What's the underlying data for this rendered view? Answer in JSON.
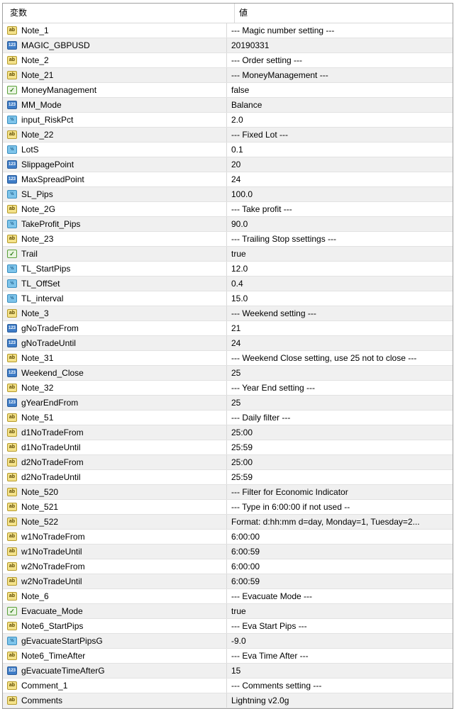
{
  "header": {
    "col_variable": "変数",
    "col_value": "値"
  },
  "icon_legend": {
    "ab": "ab",
    "n123": "123",
    "frac": "½",
    "bool": "✓"
  },
  "rows": [
    {
      "icon": "ab",
      "name": "Note_1",
      "value": "--- Magic number setting ---"
    },
    {
      "icon": "n123",
      "name": "MAGIC_GBPUSD",
      "value": "20190331"
    },
    {
      "icon": "ab",
      "name": "Note_2",
      "value": "--- Order setting ---"
    },
    {
      "icon": "ab",
      "name": "Note_21",
      "value": "--- MoneyManagement ---"
    },
    {
      "icon": "bool",
      "name": "MoneyManagement",
      "value": "false"
    },
    {
      "icon": "n123",
      "name": "MM_Mode",
      "value": "Balance"
    },
    {
      "icon": "frac",
      "name": "input_RiskPct",
      "value": "2.0"
    },
    {
      "icon": "ab",
      "name": "Note_22",
      "value": "--- Fixed Lot ---"
    },
    {
      "icon": "frac",
      "name": "LotS",
      "value": "0.1"
    },
    {
      "icon": "n123",
      "name": "SlippagePoint",
      "value": "20"
    },
    {
      "icon": "n123",
      "name": "MaxSpreadPoint",
      "value": "24"
    },
    {
      "icon": "frac",
      "name": "SL_Pips",
      "value": "100.0"
    },
    {
      "icon": "ab",
      "name": "Note_2G",
      "value": "--- Take profit ---"
    },
    {
      "icon": "frac",
      "name": "TakeProfit_Pips",
      "value": "90.0"
    },
    {
      "icon": "ab",
      "name": "Note_23",
      "value": "--- Trailing Stop ssettings ---"
    },
    {
      "icon": "bool",
      "name": "Trail",
      "value": "true"
    },
    {
      "icon": "frac",
      "name": "TL_StartPips",
      "value": "12.0"
    },
    {
      "icon": "frac",
      "name": "TL_OffSet",
      "value": "0.4"
    },
    {
      "icon": "frac",
      "name": "TL_interval",
      "value": "15.0"
    },
    {
      "icon": "ab",
      "name": "Note_3",
      "value": "--- Weekend setting ---"
    },
    {
      "icon": "n123",
      "name": "gNoTradeFrom",
      "value": "21"
    },
    {
      "icon": "n123",
      "name": "gNoTradeUntil",
      "value": "24"
    },
    {
      "icon": "ab",
      "name": "Note_31",
      "value": "--- Weekend Close setting, use 25 not to close ---"
    },
    {
      "icon": "n123",
      "name": "Weekend_Close",
      "value": "25"
    },
    {
      "icon": "ab",
      "name": "Note_32",
      "value": "--- Year End setting ---"
    },
    {
      "icon": "n123",
      "name": "gYearEndFrom",
      "value": "25"
    },
    {
      "icon": "ab",
      "name": "Note_51",
      "value": "--- Daily filter ---"
    },
    {
      "icon": "ab",
      "name": "d1NoTradeFrom",
      "value": "25:00"
    },
    {
      "icon": "ab",
      "name": "d1NoTradeUntil",
      "value": "25:59"
    },
    {
      "icon": "ab",
      "name": "d2NoTradeFrom",
      "value": "25:00"
    },
    {
      "icon": "ab",
      "name": "d2NoTradeUntil",
      "value": "25:59"
    },
    {
      "icon": "ab",
      "name": "Note_520",
      "value": "--- Filter for Economic Indicator"
    },
    {
      "icon": "ab",
      "name": "Note_521",
      "value": "--- Type in 6:00:00 if not used --"
    },
    {
      "icon": "ab",
      "name": "Note_522",
      "value": "Format: d:hh:mm d=day, Monday=1, Tuesday=2..."
    },
    {
      "icon": "ab",
      "name": "w1NoTradeFrom",
      "value": "6:00:00"
    },
    {
      "icon": "ab",
      "name": "w1NoTradeUntil",
      "value": "6:00:59"
    },
    {
      "icon": "ab",
      "name": "w2NoTradeFrom",
      "value": "6:00:00"
    },
    {
      "icon": "ab",
      "name": "w2NoTradeUntil",
      "value": "6:00:59"
    },
    {
      "icon": "ab",
      "name": "Note_6",
      "value": "--- Evacuate Mode ---"
    },
    {
      "icon": "bool",
      "name": "Evacuate_Mode",
      "value": "true"
    },
    {
      "icon": "ab",
      "name": "Note6_StartPips",
      "value": "--- Eva Start Pips ---"
    },
    {
      "icon": "frac",
      "name": "gEvacuateStartPipsG",
      "value": "-9.0"
    },
    {
      "icon": "ab",
      "name": "Note6_TimeAfter",
      "value": "--- Eva Time After ---"
    },
    {
      "icon": "n123",
      "name": "gEvacuateTimeAfterG",
      "value": "15"
    },
    {
      "icon": "ab",
      "name": "Comment_1",
      "value": "--- Comments setting ---"
    },
    {
      "icon": "ab",
      "name": "Comments",
      "value": "Lightning v2.0g"
    }
  ]
}
